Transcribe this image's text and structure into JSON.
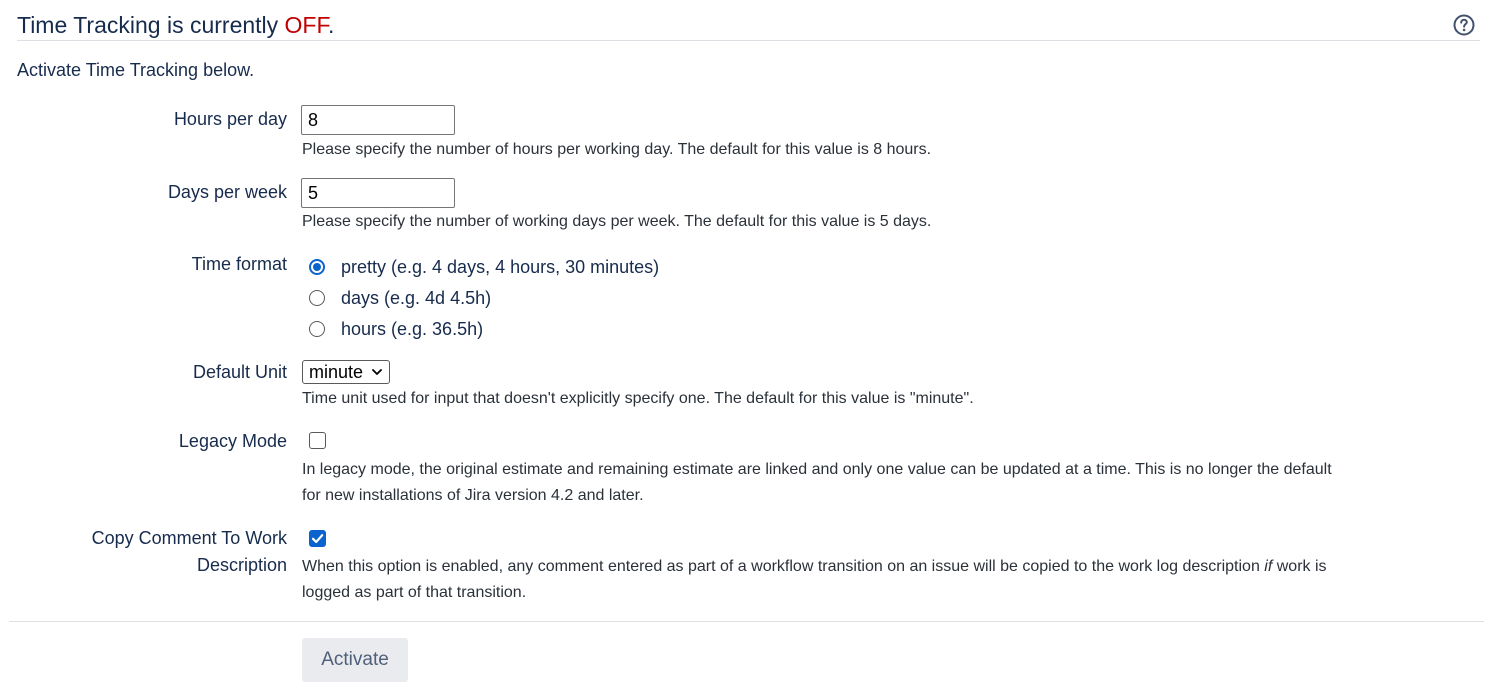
{
  "header": {
    "title_prefix": "Time Tracking is currently ",
    "title_status": "OFF",
    "title_suffix": ".",
    "status_color": "#c20000",
    "help_icon": "help-icon"
  },
  "intro": "Activate Time Tracking below.",
  "fields": {
    "hours_per_day": {
      "label": "Hours per day",
      "value": "8",
      "description": "Please specify the number of hours per working day. The default for this value is 8 hours."
    },
    "days_per_week": {
      "label": "Days per week",
      "value": "5",
      "description": "Please specify the number of working days per week. The default for this value is 5 days."
    },
    "time_format": {
      "label": "Time format",
      "options": [
        {
          "label": "pretty (e.g. 4 days, 4 hours, 30 minutes)",
          "checked": true
        },
        {
          "label": "days (e.g. 4d 4.5h)",
          "checked": false
        },
        {
          "label": "hours (e.g. 36.5h)",
          "checked": false
        }
      ]
    },
    "default_unit": {
      "label": "Default Unit",
      "selected": "minute",
      "description": "Time unit used for input that doesn't explicitly specify one. The default for this value is \"minute\"."
    },
    "legacy_mode": {
      "label": "Legacy Mode",
      "checked": false,
      "description_line1": "In legacy mode, the original estimate and remaining estimate are linked and only one value can be updated at a time. This is no longer the default",
      "description_line2": "for new installations of Jira version 4.2 and later."
    },
    "copy_comment": {
      "label_line1": "Copy Comment To Work",
      "label_line2": "Description",
      "checked": true,
      "description_pre": "When this option is enabled, any comment entered as part of a workflow transition on an issue will be copied to the work log description ",
      "description_em": "if",
      "description_post": " work is",
      "description_line2": "logged as part of that transition."
    }
  },
  "actions": {
    "activate_label": "Activate"
  },
  "colors": {
    "accent": "#0b63ce",
    "button_bg": "#e9ebee"
  }
}
